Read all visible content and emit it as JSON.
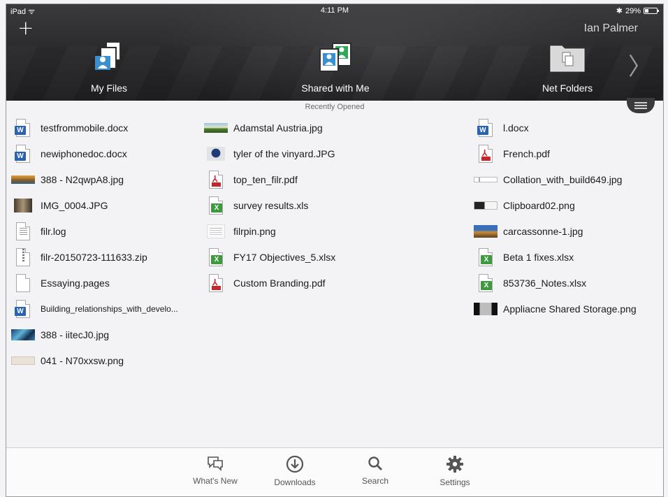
{
  "status_bar": {
    "device": "iPad",
    "time": "4:11 PM",
    "battery": "29%",
    "battery_level": 0.29
  },
  "header": {
    "user_name": "Ian Palmer",
    "nav": [
      {
        "label": "My Files",
        "icon": "my-files-icon"
      },
      {
        "label": "Shared with Me",
        "icon": "shared-with-me-icon"
      },
      {
        "label": "Net Folders",
        "icon": "net-folders-icon"
      }
    ]
  },
  "recent": {
    "title": "Recently Opened",
    "columns": [
      [
        {
          "name": "testfrommobile.docx",
          "icon": "word-doc-icon"
        },
        {
          "name": "newiphonedoc.docx",
          "icon": "word-doc-icon"
        },
        {
          "name": "388 - N2qwpA8.jpg",
          "icon": "image-thumbnail"
        },
        {
          "name": "IMG_0004.JPG",
          "icon": "image-thumbnail"
        },
        {
          "name": "filr.log",
          "icon": "text-file-icon"
        },
        {
          "name": "filr-20150723-111633.zip",
          "icon": "zip-file-icon"
        },
        {
          "name": "Essaying.pages",
          "icon": "blank-file-icon"
        },
        {
          "name": "Building_relationships_with_develo...",
          "icon": "word-doc-icon"
        },
        {
          "name": "388 - iitecJ0.jpg",
          "icon": "image-thumbnail"
        },
        {
          "name": "041 - N70xxsw.png",
          "icon": "image-thumbnail"
        }
      ],
      [
        {
          "name": "Adamstal Austria.jpg",
          "icon": "image-thumbnail"
        },
        {
          "name": "tyler of the vinyard.JPG",
          "icon": "image-thumbnail"
        },
        {
          "name": "top_ten_filr.pdf",
          "icon": "pdf-file-icon"
        },
        {
          "name": "survey results.xls",
          "icon": "excel-file-icon"
        },
        {
          "name": "filrpin.png",
          "icon": "image-thumbnail"
        },
        {
          "name": "FY17 Objectives_5.xlsx",
          "icon": "excel-file-icon"
        },
        {
          "name": "Custom Branding.pdf",
          "icon": "pdf-file-icon"
        }
      ],
      [
        {
          "name": "l.docx",
          "icon": "word-doc-icon"
        },
        {
          "name": "French.pdf",
          "icon": "pdf-file-icon"
        },
        {
          "name": "Collation_with_build649.jpg",
          "icon": "image-thumbnail"
        },
        {
          "name": "Clipboard02.png",
          "icon": "image-thumbnail"
        },
        {
          "name": "carcassonne-1.jpg",
          "icon": "image-thumbnail"
        },
        {
          "name": "Beta 1 fixes.xlsx",
          "icon": "excel-file-icon"
        },
        {
          "name": "853736_Notes.xlsx",
          "icon": "excel-file-icon"
        },
        {
          "name": "Appliacne Shared Storage.png",
          "icon": "image-thumbnail"
        }
      ]
    ]
  },
  "tabbar": [
    {
      "label": "What's New",
      "icon": "whats-new-icon"
    },
    {
      "label": "Downloads",
      "icon": "downloads-icon"
    },
    {
      "label": "Search",
      "icon": "search-icon"
    },
    {
      "label": "Settings",
      "icon": "settings-icon"
    }
  ],
  "colors": {
    "header_bg": "#2b2b2d",
    "blue_person": "#3a8fd0",
    "green_person": "#2fa85a",
    "word_blue": "#2b63b4",
    "excel_green": "#3d9a3d",
    "pdf_red": "#c8262d"
  }
}
